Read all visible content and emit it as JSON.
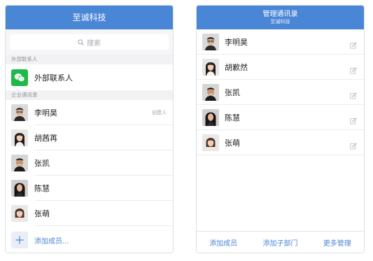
{
  "left": {
    "title": "至诚科技",
    "search": {
      "placeholder": "搜索"
    },
    "external_section": "外部联系人",
    "external_item": {
      "label": "外部联系人",
      "icon": "wechat-icon"
    },
    "enterprise_section": "企业通讯录",
    "members": [
      {
        "name": "李明昊",
        "tag": "创建人"
      },
      {
        "name": "胡茜苒",
        "tag": ""
      },
      {
        "name": "张凯",
        "tag": ""
      },
      {
        "name": "陈慧",
        "tag": ""
      },
      {
        "name": "张萌",
        "tag": ""
      }
    ],
    "add_member": "添加成员..."
  },
  "right": {
    "title": "管理通讯录",
    "subtitle": "至诚科技",
    "members": [
      {
        "name": "李明昊"
      },
      {
        "name": "胡歉然"
      },
      {
        "name": "张凯"
      },
      {
        "name": "陈慧"
      },
      {
        "name": "张萌"
      }
    ],
    "footer": {
      "add_member": "添加成员",
      "add_subdept": "添加子部门",
      "more_manage": "更多管理"
    }
  },
  "colors": {
    "accent": "#4a86d6",
    "wechat": "#1fb84a",
    "page_bg": "#f6f6f8"
  }
}
